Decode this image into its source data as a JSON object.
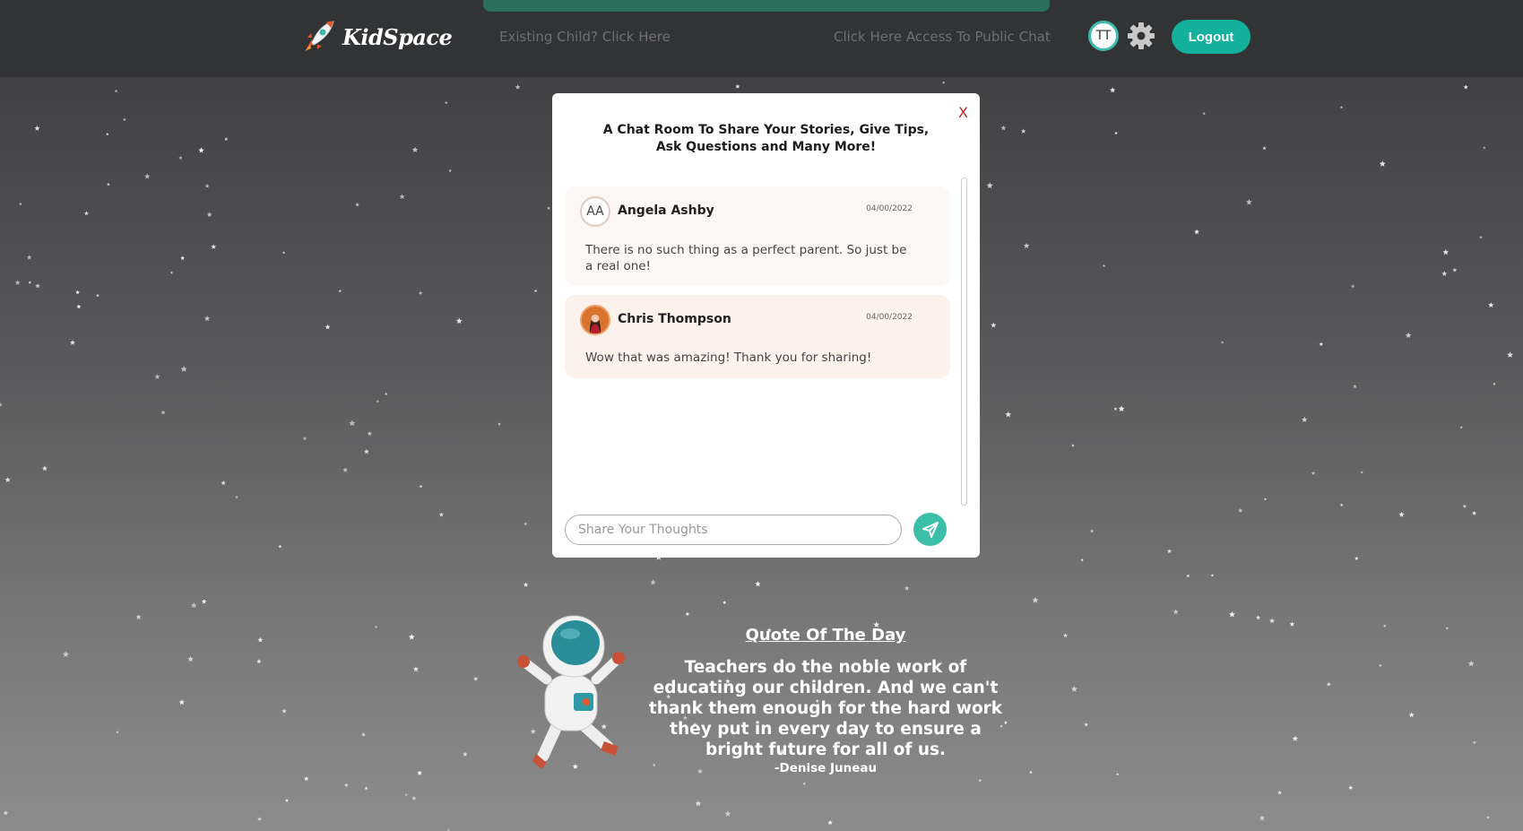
{
  "header": {
    "logo_text": "KidSpace",
    "nav_existing_child": "Existing Child? Click Here",
    "nav_public_chat": "Click Here Access To Public Chat",
    "user_initials": "TT",
    "logout_label": "Logout"
  },
  "chat_modal": {
    "close_label": "X",
    "title": "A Chat Room To Share Your Stories, Give Tips, Ask Questions and Many More!",
    "messages": [
      {
        "author": "Angela Ashby",
        "initials": "AA",
        "date": "04/00/2022",
        "text": "There is no such thing as a perfect parent. So just be a real one!"
      },
      {
        "author": "Chris Thompson",
        "date": "04/00/2022",
        "text": "Wow that was amazing! Thank you for sharing!"
      }
    ],
    "input_placeholder": "Share Your Thoughts",
    "input_value": ""
  },
  "quote": {
    "heading": "Quote Of The Day",
    "text": "Teachers do the noble work of educating our children. And we can't thank them enough for the hard work they put in every day to ensure a bright future for all of us.",
    "author": "-Denise Juneau"
  },
  "colors": {
    "accent": "#13b09c",
    "close": "#d32020",
    "header_bg": "#323335"
  },
  "icons": {
    "logo": "rocket-icon",
    "settings": "gear-icon",
    "send": "send-icon",
    "mascot": "astronaut-illustration"
  }
}
